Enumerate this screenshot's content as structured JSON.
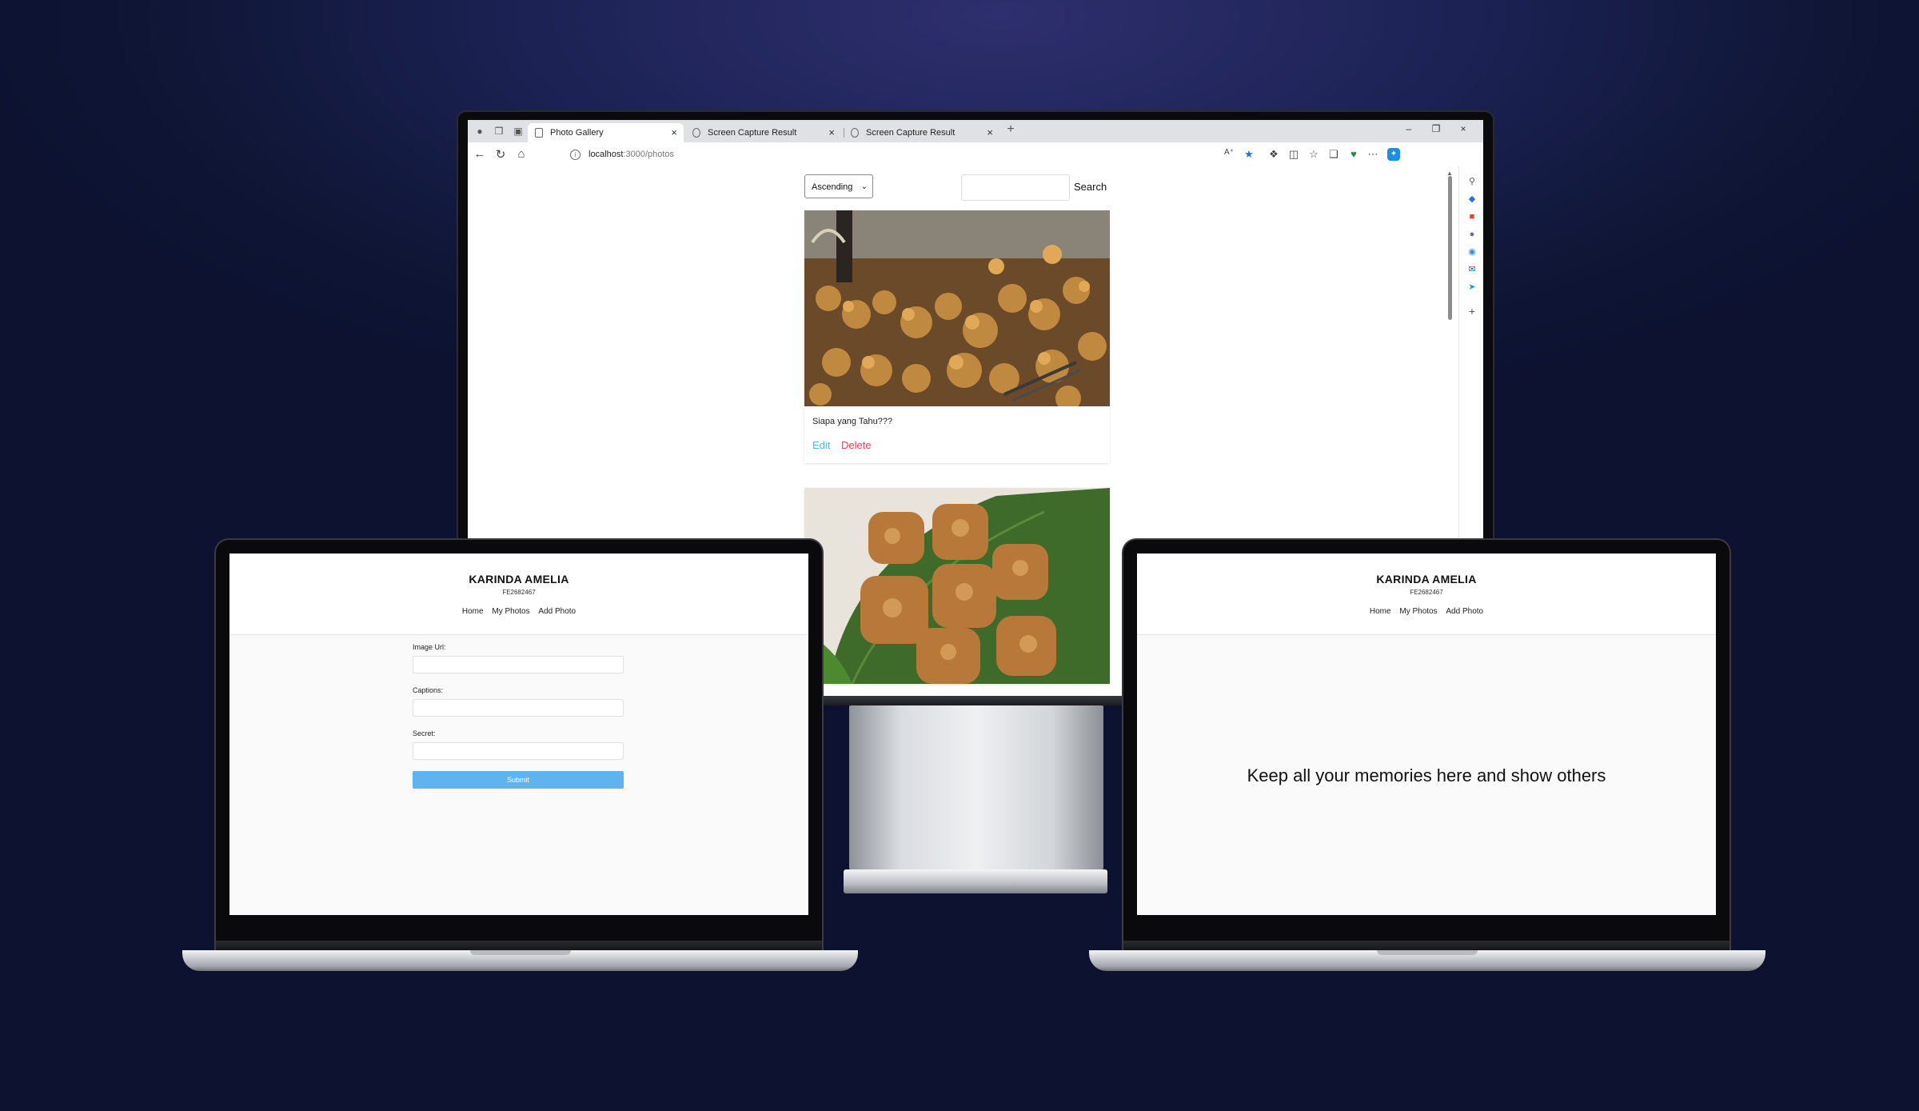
{
  "browser": {
    "tabs": [
      {
        "label": "Photo Gallery",
        "active": true
      },
      {
        "label": "Screen Capture Result",
        "active": false
      },
      {
        "label": "Screen Capture Result",
        "active": false
      }
    ],
    "url_host": "localhost",
    "url_path": ":3000/photos"
  },
  "gallery": {
    "sort_selected": "Ascending",
    "search_placeholder": "",
    "search_label": "Search",
    "photos": [
      {
        "caption": "Siapa yang Tahu???",
        "edit_label": "Edit",
        "delete_label": "Delete",
        "image": "fried tofu and tempeh in a wok"
      },
      {
        "caption": "",
        "image": "fried tofu on banana leaf with green chili"
      }
    ]
  },
  "app": {
    "name": "KARINDA AMELIA",
    "student_id": "FE2682467",
    "nav": [
      "Home",
      "My Photos",
      "Add Photo"
    ]
  },
  "add_photo_form": {
    "fields": [
      {
        "label": "Image Url:",
        "value": ""
      },
      {
        "label": "Captions:",
        "value": ""
      },
      {
        "label": "Secret:",
        "value": ""
      }
    ],
    "submit_label": "Submit"
  },
  "home": {
    "tagline": "Keep all your memories here and show others"
  },
  "colors": {
    "background": "#141b45",
    "edit_link": "#58b3e8",
    "delete_link": "#ee3e4e",
    "submit_button": "#5fb4ef"
  }
}
